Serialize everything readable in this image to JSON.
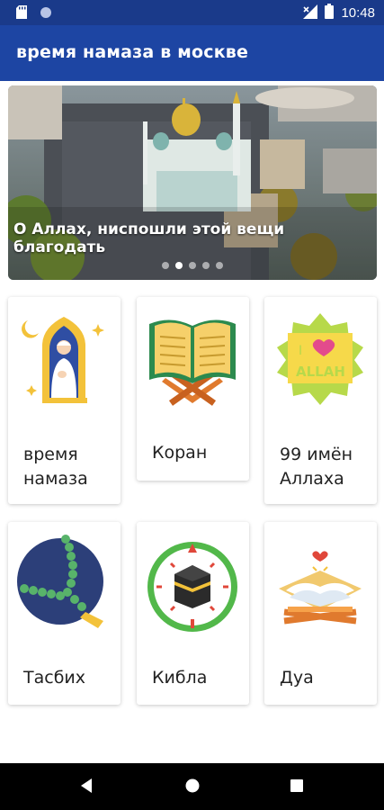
{
  "status_bar": {
    "time": "10:48",
    "icons": [
      "sd-card-icon",
      "circle-icon",
      "signal-icon",
      "battery-icon"
    ]
  },
  "app_bar": {
    "title": "время намаза в москве"
  },
  "banner": {
    "caption": "О Аллах, ниспошли этой вещи благодать",
    "slide_count": 5,
    "active_slide": 2
  },
  "grid": {
    "items": [
      {
        "label": "время намаза",
        "icon": "prayer-man-icon"
      },
      {
        "label": "Коран",
        "icon": "quran-book-icon"
      },
      {
        "label": "99 имён Аллаха",
        "icon": "i-love-allah-icon"
      },
      {
        "label": "Тасбих",
        "icon": "tasbih-beads-icon"
      },
      {
        "label": "Кибла",
        "icon": "qibla-compass-icon"
      },
      {
        "label": "Дуа",
        "icon": "dua-book-icon"
      }
    ]
  },
  "nav_bar": {
    "buttons": [
      "back-icon",
      "home-icon",
      "recents-icon"
    ]
  },
  "colors": {
    "status_bar": "#1a3a8a",
    "app_bar": "#1d45a3",
    "nav_bar": "#000000"
  }
}
